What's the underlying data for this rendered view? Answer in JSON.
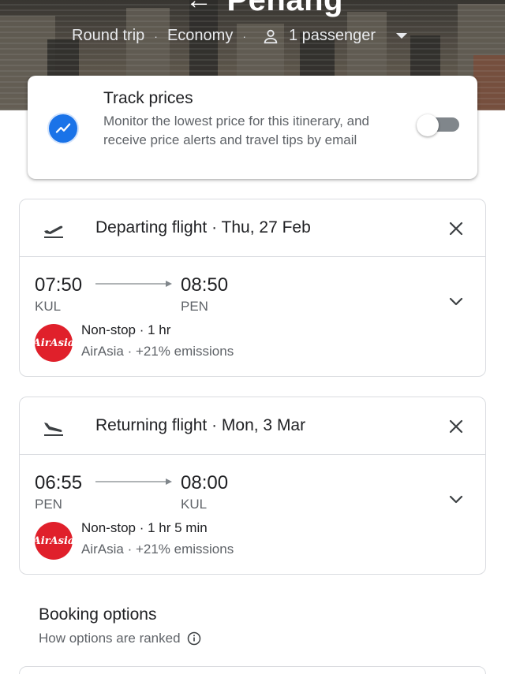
{
  "header": {
    "destination": "Penang",
    "trip_type": "Round trip",
    "cabin": "Economy",
    "passengers": "1 passenger"
  },
  "track": {
    "title": "Track prices",
    "description": "Monitor the lowest price for this itinerary, and receive price alerts and travel tips by email",
    "enabled": false
  },
  "flights": [
    {
      "title": "Departing flight · Thu, 27 Feb",
      "dep_time": "07:50",
      "arr_time": "08:50",
      "dep_code": "KUL",
      "arr_code": "PEN",
      "duration": "Non-stop · 1 hr",
      "airline": "AirAsia · +21% emissions",
      "logo": "AirAsia"
    },
    {
      "title": "Returning flight · Mon, 3 Mar",
      "dep_time": "06:55",
      "arr_time": "08:00",
      "dep_code": "PEN",
      "arr_code": "KUL",
      "duration": "Non-stop · 1 hr 5 min",
      "airline": "AirAsia · +21% emissions",
      "logo": "AirAsia"
    }
  ],
  "booking": {
    "title": "Booking options",
    "subtitle": "How options are ranked"
  },
  "colors": {
    "accent": "#1a73e8",
    "airline_brand": "#e0202b",
    "border": "#dadce0",
    "muted_text": "#5f6368"
  }
}
